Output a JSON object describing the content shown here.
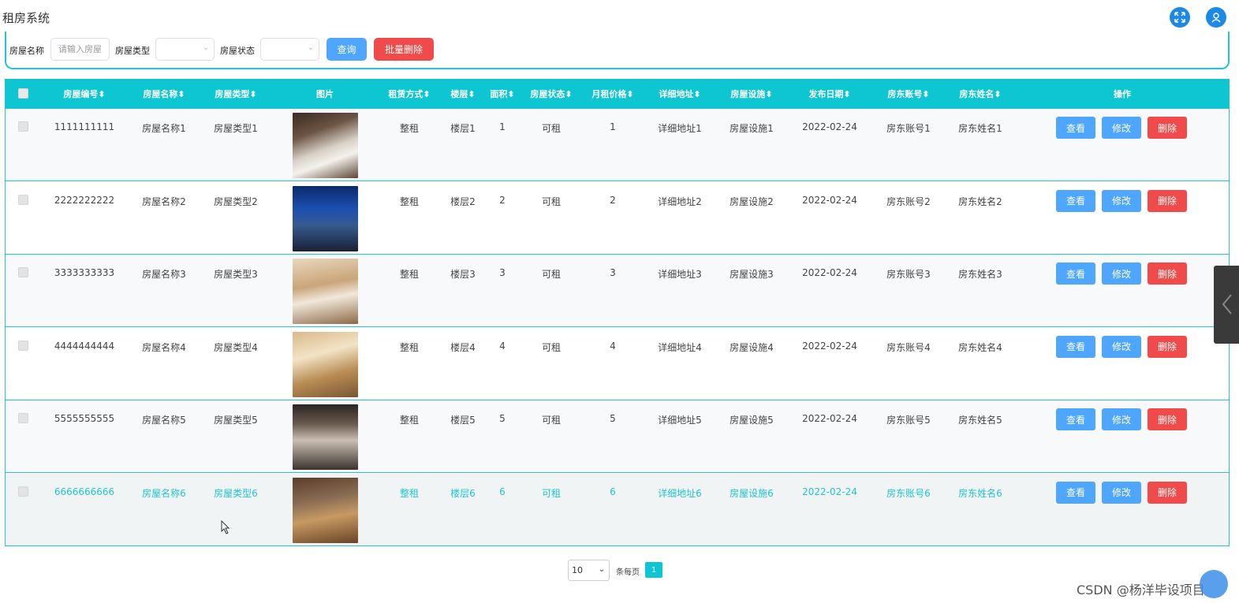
{
  "app": {
    "title": "租房系统"
  },
  "header": {
    "fullscreen_icon": "fullscreen-icon",
    "user_icon": "user-icon"
  },
  "search": {
    "name_label": "房屋名称",
    "name_placeholder": "请输入房屋",
    "type_label": "房屋类型",
    "type_value": "",
    "status_label": "房屋状态",
    "status_value": "",
    "query_label": "查询",
    "batch_delete_label": "批量删除"
  },
  "colors": {
    "accent": "#0ec6d2",
    "primary": "#409eff",
    "danger": "#f04a4a"
  },
  "table": {
    "headers": {
      "code": "房屋编号",
      "name": "房屋名称",
      "type": "房屋类型",
      "image": "图片",
      "lease": "租赁方式",
      "floor": "楼层",
      "area": "面积",
      "status": "房屋状态",
      "price": "月租价格",
      "address": "详细地址",
      "facility": "房屋设施",
      "date": "发布日期",
      "owner_account": "房东账号",
      "owner_name": "房东姓名",
      "actions": "操作"
    },
    "sort_icon": "sort-icon",
    "rows": [
      {
        "code": "1111111111",
        "name": "房屋名称1",
        "type": "房屋类型1",
        "lease": "整租",
        "floor": "楼层1",
        "area": "1",
        "status": "可租",
        "price": "1",
        "address": "详细地址1",
        "facility": "房屋设施1",
        "date": "2022-02-24",
        "owner_account": "房东账号1",
        "owner_name": "房东姓名1"
      },
      {
        "code": "2222222222",
        "name": "房屋名称2",
        "type": "房屋类型2",
        "lease": "整租",
        "floor": "楼层2",
        "area": "2",
        "status": "可租",
        "price": "2",
        "address": "详细地址2",
        "facility": "房屋设施2",
        "date": "2022-02-24",
        "owner_account": "房东账号2",
        "owner_name": "房东姓名2"
      },
      {
        "code": "3333333333",
        "name": "房屋名称3",
        "type": "房屋类型3",
        "lease": "整租",
        "floor": "楼层3",
        "area": "3",
        "status": "可租",
        "price": "3",
        "address": "详细地址3",
        "facility": "房屋设施3",
        "date": "2022-02-24",
        "owner_account": "房东账号3",
        "owner_name": "房东姓名3"
      },
      {
        "code": "4444444444",
        "name": "房屋名称4",
        "type": "房屋类型4",
        "lease": "整租",
        "floor": "楼层4",
        "area": "4",
        "status": "可租",
        "price": "4",
        "address": "详细地址4",
        "facility": "房屋设施4",
        "date": "2022-02-24",
        "owner_account": "房东账号4",
        "owner_name": "房东姓名4"
      },
      {
        "code": "5555555555",
        "name": "房屋名称5",
        "type": "房屋类型5",
        "lease": "整租",
        "floor": "楼层5",
        "area": "5",
        "status": "可租",
        "price": "5",
        "address": "详细地址5",
        "facility": "房屋设施5",
        "date": "2022-02-24",
        "owner_account": "房东账号5",
        "owner_name": "房东姓名5"
      },
      {
        "code": "6666666666",
        "name": "房屋名称6",
        "type": "房屋类型6",
        "lease": "整租",
        "floor": "楼层6",
        "area": "6",
        "status": "可租",
        "price": "6",
        "address": "详细地址6",
        "facility": "房屋设施6",
        "date": "2022-02-24",
        "owner_account": "房东账号6",
        "owner_name": "房东姓名6"
      }
    ],
    "actions": {
      "view": "查看",
      "edit": "修改",
      "delete": "删除"
    }
  },
  "pagination": {
    "page_size": "10",
    "per_page_label": "条每页",
    "current_page": "1"
  },
  "watermark": "CSDN @杨洋毕设项目"
}
